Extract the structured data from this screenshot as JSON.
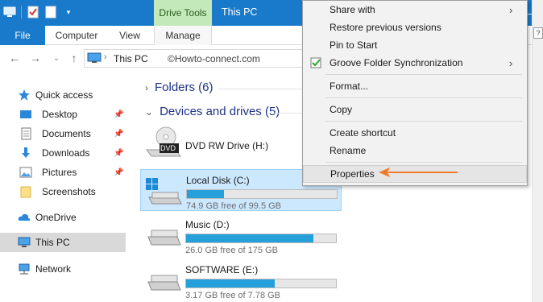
{
  "window": {
    "title": "This PC",
    "context_tab": "Drive Tools",
    "colors": {
      "titlebar": "#1979ca",
      "drive_tools": "#c3e8b9",
      "selection": "#cce8ff",
      "usage_fill": "#26a0da",
      "annotation_arrow": "#f07b2a"
    }
  },
  "ribbon": {
    "tabs": {
      "file": "File",
      "computer": "Computer",
      "view": "View",
      "manage": "Manage"
    }
  },
  "address": {
    "path": "This PC",
    "watermark": "©Howto-connect.com"
  },
  "sidebar": {
    "quick_access": "Quick access",
    "items": [
      {
        "label": "Desktop",
        "icon": "desktop-icon",
        "pinned": true
      },
      {
        "label": "Documents",
        "icon": "documents-icon",
        "pinned": true
      },
      {
        "label": "Downloads",
        "icon": "downloads-icon",
        "pinned": true
      },
      {
        "label": "Pictures",
        "icon": "pictures-icon",
        "pinned": true
      },
      {
        "label": "Screenshots",
        "icon": "folder-icon",
        "pinned": false
      }
    ],
    "onedrive": "OneDrive",
    "this_pc": "This PC",
    "network": "Network"
  },
  "content": {
    "folders_header": "Folders (6)",
    "devices_header": "Devices and drives (5)",
    "drives": [
      {
        "name": "DVD RW Drive (H:)",
        "type": "dvd",
        "badge": "DVD"
      },
      {
        "name": "Local Disk (C:)",
        "type": "windows-disk",
        "free": "74.9 GB free of 99.5 GB",
        "used_fraction": 0.247,
        "selected": true
      },
      {
        "name": "Music (D:)",
        "type": "disk",
        "free": "26.0 GB free of 175 GB",
        "used_fraction": 0.851,
        "selected": false
      },
      {
        "name": "SOFTWARE (E:)",
        "type": "disk",
        "free": "3.17 GB free of 7.78 GB",
        "used_fraction": 0.593,
        "selected": false
      }
    ]
  },
  "context_menu": {
    "share_with": "Share with",
    "restore_versions": "Restore previous versions",
    "pin_to_start": "Pin to Start",
    "groove_sync": "Groove Folder Synchronization",
    "format": "Format...",
    "copy": "Copy",
    "create_shortcut": "Create shortcut",
    "rename": "Rename",
    "properties": "Properties"
  }
}
